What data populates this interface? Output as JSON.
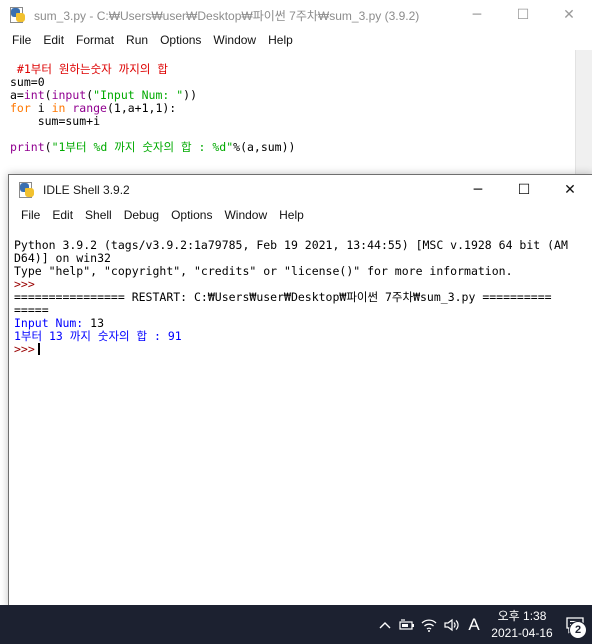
{
  "editor": {
    "title": "sum_3.py - C:₩Users₩user₩Desktop₩파이썬 7주차₩sum_3.py (3.9.2)",
    "menu": [
      "File",
      "Edit",
      "Format",
      "Run",
      "Options",
      "Window",
      "Help"
    ],
    "code": {
      "comment": " #1부터 원하는숫자 까지의 합",
      "line2": "sum=0",
      "line3_pre": "a=",
      "line3_int": "int",
      "line3_paren": "(",
      "line3_input": "input",
      "line3_str": "\"Input Num: \"",
      "line3_close": "))",
      "line4_for": "for",
      "line4_i": " i ",
      "line4_in": "in",
      "line4_sp": " ",
      "line4_range": "range",
      "line4_rest": "(1,a+1,1):",
      "line5": "    sum=sum+i",
      "line7_print": "print",
      "line7_paren": "(",
      "line7_str": "\"1부터 %d 까지 숫자의 합 : %d\"",
      "line7_rest": "%(a,sum))"
    }
  },
  "shell": {
    "title": "IDLE Shell 3.9.2",
    "menu": [
      "File",
      "Edit",
      "Shell",
      "Debug",
      "Options",
      "Window",
      "Help"
    ],
    "banner1": "Python 3.9.2 (tags/v3.9.2:1a79785, Feb 19 2021, 13:44:55) [MSC v.1928 64 bit (AM",
    "banner2": "D64)] on win32",
    "banner3": "Type \"help\", \"copyright\", \"credits\" or \"license()\" for more information.",
    "prompt": ">>>",
    "restart1": "================ RESTART: C:₩Users₩user₩Desktop₩파이썬 7주차₩sum_3.py ==========",
    "restart2": "=====",
    "input_label": "Input Num: ",
    "input_value": "13",
    "result": "1부터 13 까지 숫자의 합 : 91"
  },
  "window_controls": {
    "minimize": "─",
    "maximize": "☐",
    "close": "✕"
  },
  "taskbar": {
    "ime": "A",
    "time": "오후 1:38",
    "date": "2021-04-16",
    "notifications": "2"
  }
}
